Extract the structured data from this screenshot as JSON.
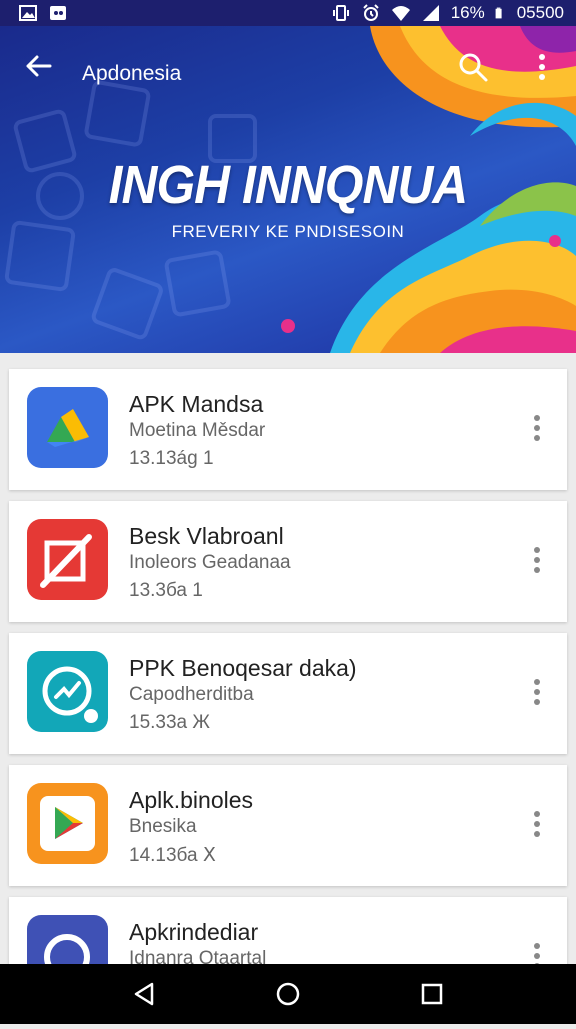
{
  "status_bar": {
    "battery_text": "16%",
    "time": "05500",
    "icons": [
      "gallery-icon",
      "game-icon",
      "vibrate-icon",
      "alarm-icon",
      "wifi-icon",
      "signal-icon",
      "battery-icon"
    ]
  },
  "header": {
    "app_title": "Apdonesia",
    "banner_title": "INGH INNQNUA",
    "banner_subtitle": "FREVERIY KE PNDISESOIN",
    "colors": {
      "background": "#1d3fa6",
      "accent_orange": "#f7931e",
      "accent_pink": "#e8308a",
      "accent_cyan": "#29b6e8"
    }
  },
  "apps": [
    {
      "name": "APK Mandsa",
      "developer": "Moetina Měsdar",
      "meta": "13.13ág 1",
      "icon": "drive-icon",
      "icon_bg": "#3a6fe0"
    },
    {
      "name": "Besk Vlabroanl",
      "developer": "Inoleors Geadanaa",
      "meta": "13.3ба 1",
      "icon": "edit-icon",
      "icon_bg": "#e53935"
    },
    {
      "name": "PPK Benoqesar daka)",
      "developer": "Capodherditba",
      "meta": "15.33a Ж",
      "icon": "speedtest-icon",
      "icon_bg": "#12a7b8"
    },
    {
      "name": "Aplk.binoles",
      "developer": "Bnesika",
      "meta": "14.13ба Ⅹ",
      "icon": "play-icon",
      "icon_bg": "#f7931e"
    },
    {
      "name": "Apkrindediar",
      "developer": "Idnanra Otaartal",
      "meta": "",
      "icon": "app-icon",
      "icon_bg": "#3f51b5"
    }
  ],
  "nav": {
    "icons": [
      "back-nav-icon",
      "home-nav-icon",
      "recents-nav-icon"
    ]
  }
}
